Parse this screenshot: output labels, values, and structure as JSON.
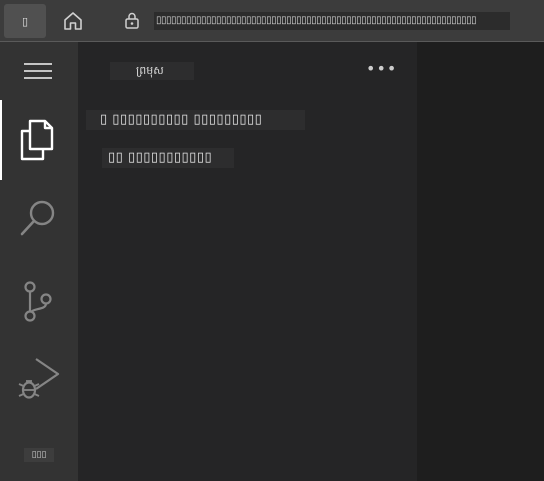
{
  "browser": {
    "tab_label": "▯",
    "address_text": "▯▯▯▯▯▯▯▯▯▯▯▯▯▯▯▯▯▯▯▯▯▯▯▯▯▯▯▯▯▯▯▯▯▯▯▯▯▯▯▯▯▯▯▯▯▯▯▯▯▯▯▯▯▯▯▯▯▯▯▯▯▯▯▯"
  },
  "activity_bar": {
    "items": [
      {
        "name": "explorer",
        "icon": "files-icon",
        "active": true
      },
      {
        "name": "search",
        "icon": "search-icon",
        "active": false
      },
      {
        "name": "source-control",
        "icon": "source-control-icon",
        "active": false
      },
      {
        "name": "run-and-debug",
        "icon": "debug-icon",
        "active": false
      }
    ],
    "bottom_label": "▯▯▯"
  },
  "sidebar": {
    "title": "ព្រមុស",
    "more_label": "•••",
    "message_line1": "▯ ▯▯▯▯▯▯▯▯▯▯ ▯▯▯▯▯▯▯▯▯",
    "message_line2": "▯▯ ▯▯▯▯▯▯▯▯▯▯▯"
  },
  "colors": {
    "activity_bar_bg": "#333333",
    "sidebar_bg": "#252526",
    "editor_bg": "#1e1e1e",
    "browser_bar_bg": "#3c3c3c",
    "active_indicator": "#ffffff"
  }
}
